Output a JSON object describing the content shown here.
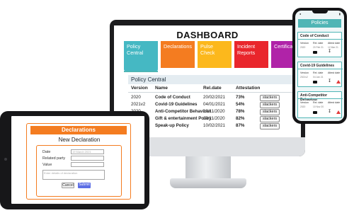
{
  "dashboard": {
    "title": "DASHBOARD",
    "tiles": [
      {
        "label": "Policy Central",
        "color": "#45b8c3"
      },
      {
        "label": "Declarations",
        "color": "#f47c20"
      },
      {
        "label": "Pulse Check",
        "color": "#fcb81c"
      },
      {
        "label": "Incident Reports",
        "color": "#e9262c"
      },
      {
        "label": "Certificates",
        "color": "#b023a8"
      }
    ],
    "section_title": "Policy Central",
    "columns": [
      "Version",
      "Name",
      "Rel.date",
      "Attestation"
    ],
    "rows": [
      {
        "version": "2020",
        "name": "Code of Conduct",
        "date": "20/02/2021",
        "attestation": "73%",
        "action": "slackers"
      },
      {
        "version": "2021v2",
        "name": "Covid-19 Guidelines",
        "date": "04/01/2021",
        "attestation": "54%",
        "action": "slackers"
      },
      {
        "version": "2020",
        "name": "Anti-Competitor Behaviour",
        "date": "10/11/2020",
        "attestation": "78%",
        "action": "slackers"
      },
      {
        "version": "2020",
        "name": "Gift & entertainment Policy",
        "date": "10/11/2020",
        "attestation": "82%",
        "action": "slackers"
      },
      {
        "version": "2020",
        "name": "Speak-up Policy",
        "date": "10/02/2021",
        "attestation": "87%",
        "action": "slackers"
      }
    ]
  },
  "tablet": {
    "header": "Declarations",
    "subtitle": "New Declaration",
    "fields": {
      "date_label": "Date",
      "date_value": "19 March 2021",
      "party_label": "Related party",
      "value_label": "Value",
      "details_placeholder": "Enter details of declaration"
    },
    "cancel": "Cancel",
    "submit": "Submit"
  },
  "phone": {
    "title": "Policies",
    "cards": [
      {
        "title": "Code of Conduct",
        "version_label": "Version",
        "version": "2020",
        "rel_label": "Rel. date",
        "rel": "20 Feb 21",
        "attest_label": "Attest date",
        "attest": "12 Mar 21"
      },
      {
        "title": "Covid-19 Guidelines",
        "version_label": "Version",
        "version": "2021v2",
        "rel_label": "Rel. date",
        "rel": "04 Jan 21",
        "attest_label": "Attest date",
        "attest": "—"
      },
      {
        "title": "Anti-Competitor Behaviour",
        "version_label": "Version",
        "version": "2020",
        "rel_label": "Rel. date",
        "rel": "10 Nov 20",
        "attest_label": "Attest date",
        "attest": "—"
      }
    ]
  }
}
